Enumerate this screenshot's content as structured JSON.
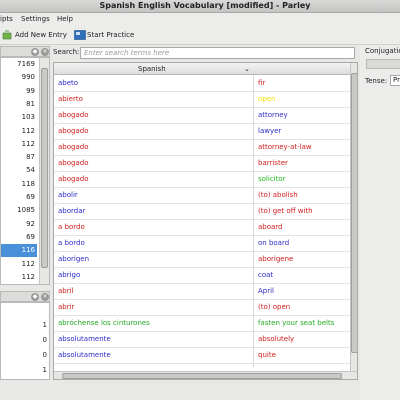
{
  "window": {
    "title": "Spanish English Vocabulary [modified] - Parley"
  },
  "menu": {
    "items": [
      "ipts",
      "Settings",
      "Help"
    ]
  },
  "toolbar": {
    "add_entry": "Add New Entry",
    "start_practice": "Start Practice"
  },
  "search": {
    "label": "Search:",
    "placeholder": "Enter search terms here"
  },
  "left_top": {
    "values": [
      "7169",
      "990",
      "99",
      "81",
      "103",
      "112",
      "112",
      "87",
      "54",
      "118",
      "69",
      "1085",
      "92",
      "69",
      "116",
      "112",
      "112"
    ],
    "selected_index": 14
  },
  "left_bottom": {
    "values": [
      "",
      "1",
      "0",
      "0",
      "1"
    ]
  },
  "table": {
    "header": {
      "spanish": "Spanish"
    },
    "rows": [
      {
        "es": "abeto",
        "en": "fir",
        "es_color": "#2c2cc8",
        "en_color": "#d01c1c"
      },
      {
        "es": "abierto",
        "en": "open",
        "es_color": "#d01c1c",
        "en_color": "#f0e000"
      },
      {
        "es": "abogado",
        "en": "attorney",
        "es_color": "#d01c1c",
        "en_color": "#2c2cc8"
      },
      {
        "es": "abogado",
        "en": "lawyer",
        "es_color": "#d01c1c",
        "en_color": "#2c2cc8"
      },
      {
        "es": "abogado",
        "en": "attorney-at-law",
        "es_color": "#d01c1c",
        "en_color": "#d01c1c"
      },
      {
        "es": "abogado",
        "en": "barrister",
        "es_color": "#d01c1c",
        "en_color": "#d01c1c"
      },
      {
        "es": "abogado",
        "en": "solicitor",
        "es_color": "#d01c1c",
        "en_color": "#22bb22"
      },
      {
        "es": "abolir",
        "en": "(to) abolish",
        "es_color": "#2c2cc8",
        "en_color": "#d01c1c"
      },
      {
        "es": "abordar",
        "en": "(to) get off with",
        "es_color": "#2c2cc8",
        "en_color": "#d01c1c"
      },
      {
        "es": "a bordo",
        "en": "aboard",
        "es_color": "#d01c1c",
        "en_color": "#d01c1c"
      },
      {
        "es": "a bordo",
        "en": "on board",
        "es_color": "#2c2cc8",
        "en_color": "#2c2cc8"
      },
      {
        "es": "aborigen",
        "en": "aborigene",
        "es_color": "#2c2cc8",
        "en_color": "#d01c1c"
      },
      {
        "es": "abrigo",
        "en": "coat",
        "es_color": "#2c2cc8",
        "en_color": "#2c2cc8"
      },
      {
        "es": "abril",
        "en": "April",
        "es_color": "#d01c1c",
        "en_color": "#2c2cc8"
      },
      {
        "es": "abrir",
        "en": "(to) open",
        "es_color": "#d01c1c",
        "en_color": "#d01c1c"
      },
      {
        "es": "abróchense los cinturones",
        "en": "fasten your seat belts",
        "es_color": "#22aa22",
        "en_color": "#22aa22"
      },
      {
        "es": "absolutamente",
        "en": "absolutely",
        "es_color": "#2c2cc8",
        "en_color": "#d01c1c"
      },
      {
        "es": "absolutamente",
        "en": "quite",
        "es_color": "#2c2cc8",
        "en_color": "#d01c1c"
      }
    ]
  },
  "right_panel": {
    "conjugation_label": "Conjugation",
    "tense_label": "Tense:",
    "tense_value": "Pr"
  },
  "colors": {
    "selection": "#4a90d9"
  }
}
